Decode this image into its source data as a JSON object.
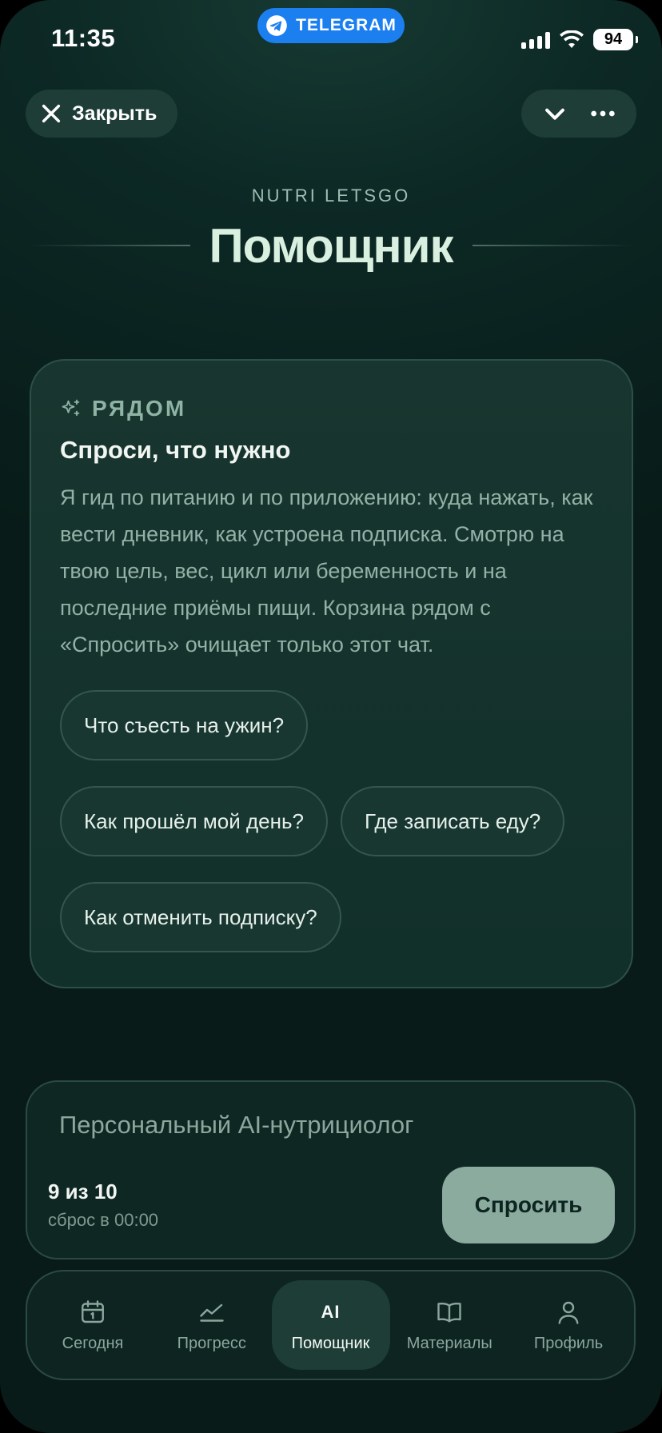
{
  "status_bar": {
    "time": "11:35",
    "telegram_label": "TELEGRAM",
    "battery": "94"
  },
  "header": {
    "close_label": "Закрыть",
    "brand": "NUTRI LETSGO",
    "title": "Помощник"
  },
  "card": {
    "tag": "РЯДОМ",
    "title": "Спроси, что нужно",
    "text": "Я гид по питанию и по приложению: куда нажать, как вести дневник, как устроена подписка. Смотрю на твою цель, вес, цикл или беременность и на последние приёмы пищи. Корзина рядом с «Спросить» очищает только этот чат.",
    "suggestions": [
      "Что съесть на ужин?",
      "Как прошёл мой день?",
      "Где записать еду?",
      "Как отменить подписку?"
    ]
  },
  "ask": {
    "placeholder": "Персональный AI-нутрициолог",
    "quota": "9 из 10",
    "reset": "сброс в 00:00",
    "button": "Спросить"
  },
  "nav": {
    "items": [
      {
        "label": "Сегодня",
        "icon": "calendar-icon"
      },
      {
        "label": "Прогресс",
        "icon": "chart-icon"
      },
      {
        "label": "Помощник",
        "icon": "ai-icon",
        "glyph": "AI"
      },
      {
        "label": "Материалы",
        "icon": "book-icon"
      },
      {
        "label": "Профиль",
        "icon": "user-icon"
      }
    ],
    "active_index": 2
  },
  "colors": {
    "accent": "#8aab9d",
    "telegram": "#1c7ff0",
    "background": "#0a211e"
  }
}
